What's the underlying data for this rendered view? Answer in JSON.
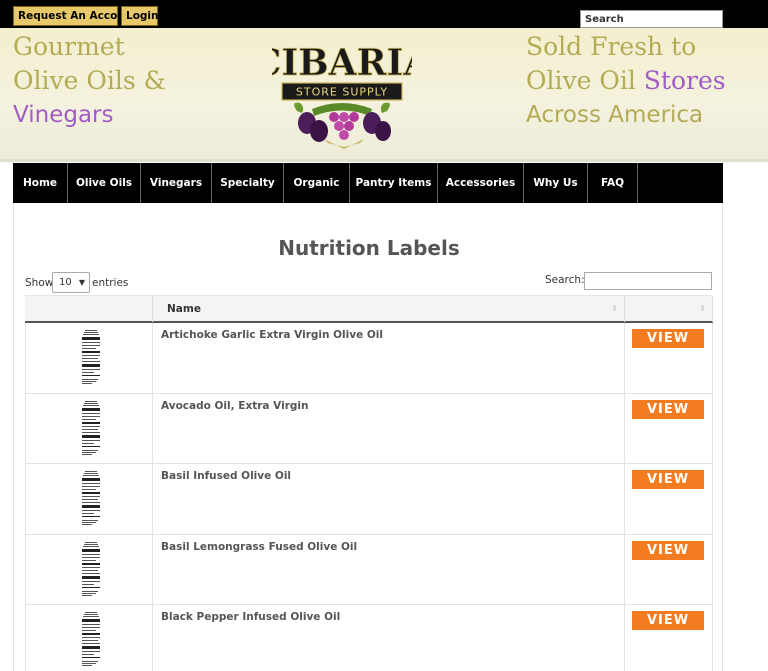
{
  "topbar": {
    "request_account_label": "Request An Account",
    "login_label": "Login",
    "search_placeholder": "Search"
  },
  "header": {
    "tagline_left": [
      "Gourmet",
      "Olive Oils &",
      "Vinegars"
    ],
    "tagline_right": {
      "line1": "Sold Fresh to",
      "line2_main": "Olive Oil ",
      "line2_accent": "Stores",
      "line3": "Across America"
    },
    "logo": {
      "name": "CIBARIA",
      "subtitle": "STORE SUPPLY",
      "icon": "grapes-olives-logo"
    },
    "colors": {
      "gold": "#b4ab55",
      "purple": "#a25cc6"
    }
  },
  "nav": {
    "items": [
      {
        "label": "Home"
      },
      {
        "label": "Olive Oils"
      },
      {
        "label": "Vinegars"
      },
      {
        "label": "Specialty"
      },
      {
        "label": "Organic"
      },
      {
        "label": "Pantry Items"
      },
      {
        "label": "Accessories"
      },
      {
        "label": "Why Us"
      },
      {
        "label": "FAQ"
      }
    ]
  },
  "main": {
    "title": "Nutrition Labels",
    "show_label": "Show",
    "length_value": "10",
    "entries_label": "entries",
    "search_label": "Search:",
    "search_value": ""
  },
  "table": {
    "columns": [
      "",
      "Name",
      ""
    ],
    "view_label": "VIEW",
    "view_color": "#f47c20",
    "rows": [
      {
        "name": "Artichoke Garlic Extra Virgin Olive Oil"
      },
      {
        "name": "Avocado Oil, Extra Virgin"
      },
      {
        "name": "Basil Infused Olive Oil"
      },
      {
        "name": "Basil Lemongrass Fused Olive Oil"
      },
      {
        "name": "Black Pepper Infused Olive Oil"
      }
    ]
  }
}
